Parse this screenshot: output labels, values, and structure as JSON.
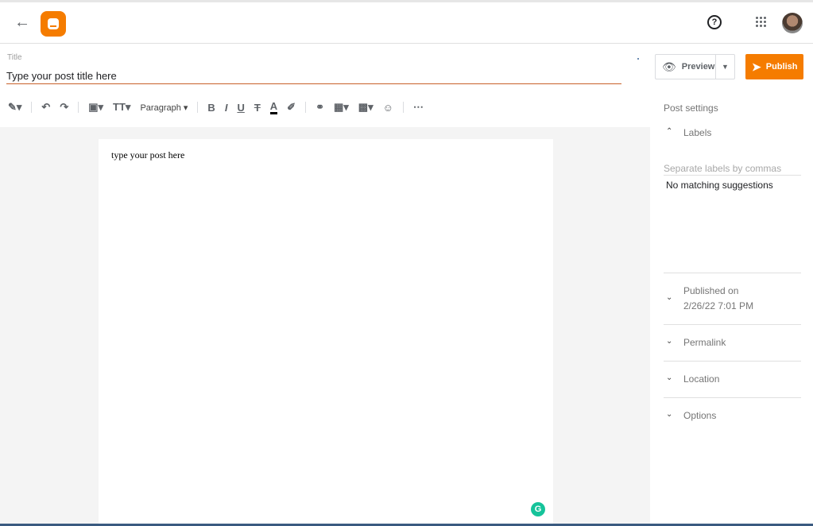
{
  "header": {
    "back_icon": "arrow-left-icon",
    "logo": "blogger-logo",
    "help_icon": "help-circle-icon",
    "apps_icon": "grid-apps-icon"
  },
  "title": {
    "label": "Title",
    "value": "Type your post title here"
  },
  "actions": {
    "preview": "Preview",
    "publish": "Publish"
  },
  "toolbar": {
    "paragraph": "Paragraph"
  },
  "editor": {
    "body": "type your post here",
    "grammarly": "G"
  },
  "sidebar": {
    "title": "Post settings",
    "labels": {
      "heading": "Labels",
      "placeholder": "Separate labels by commas",
      "suggestion": "No matching suggestions"
    },
    "published": {
      "heading": "Published on",
      "value": "2/26/22 7:01 PM"
    },
    "permalink": "Permalink",
    "location": "Location",
    "options": "Options"
  },
  "colors": {
    "accent": "#f57c00",
    "grammarly": "#15c39a"
  }
}
